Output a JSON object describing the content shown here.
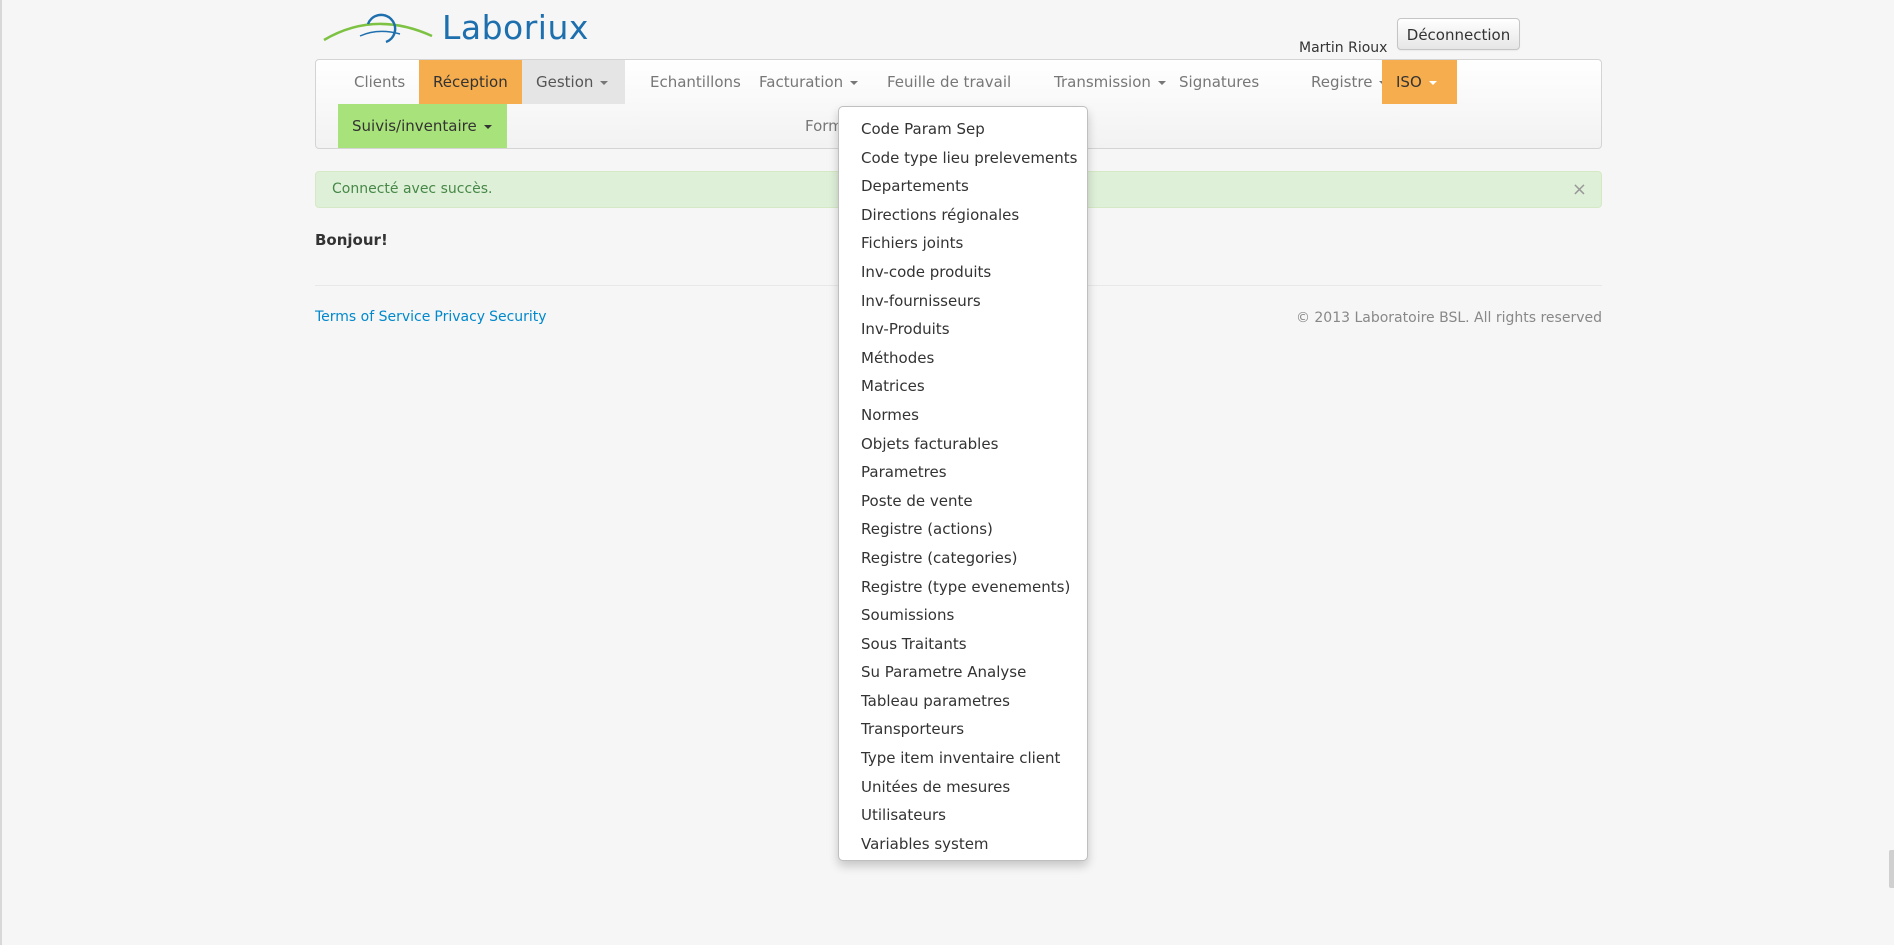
{
  "header": {
    "logo_text": "Laboriux",
    "username": "Martin Rioux",
    "logout_label": "Déconnection"
  },
  "colors": {
    "orange_tab": "#f6ad4d",
    "green_tab": "#a8e27a",
    "alert_bg": "#dff0d8",
    "alert_text": "#468847",
    "link": "#0088cc",
    "logo_blue": "#1e6fae",
    "logo_green": "#7dc242"
  },
  "nav": {
    "clients": "Clients",
    "reception": "Réception",
    "gestion": "Gestion",
    "echantillons": "Echantillons",
    "facturation": "Facturation",
    "feuille": "Feuille de travail",
    "transmission": "Transmission",
    "signatures": "Signatures",
    "registre": "Registre",
    "iso": "ISO",
    "suivis": "Suivis/inventaire",
    "formulaires": "Formulaires laboratoire"
  },
  "alert": {
    "message": "Connecté avec succès.",
    "close": "×"
  },
  "main": {
    "greeting": "Bonjour!"
  },
  "footer": {
    "terms": "Terms of Service",
    "privacy": "Privacy",
    "security": "Security",
    "copyright": "© 2013 Laboratoire BSL. All rights reserved"
  },
  "gestion_menu": [
    "Code Param Sep",
    "Code type lieu prelevements",
    "Departements",
    "Directions régionales",
    "Fichiers joints",
    "Inv-code produits",
    "Inv-fournisseurs",
    "Inv-Produits",
    "Méthodes",
    "Matrices",
    "Normes",
    "Objets facturables",
    "Parametres",
    "Poste de vente",
    "Registre (actions)",
    "Registre (categories)",
    "Registre (type evenements)",
    "Soumissions",
    "Sous Traitants",
    "Su Parametre Analyse",
    "Tableau parametres",
    "Transporteurs",
    "Type item inventaire client",
    "Unitées de mesures",
    "Utilisateurs",
    "Variables system"
  ]
}
